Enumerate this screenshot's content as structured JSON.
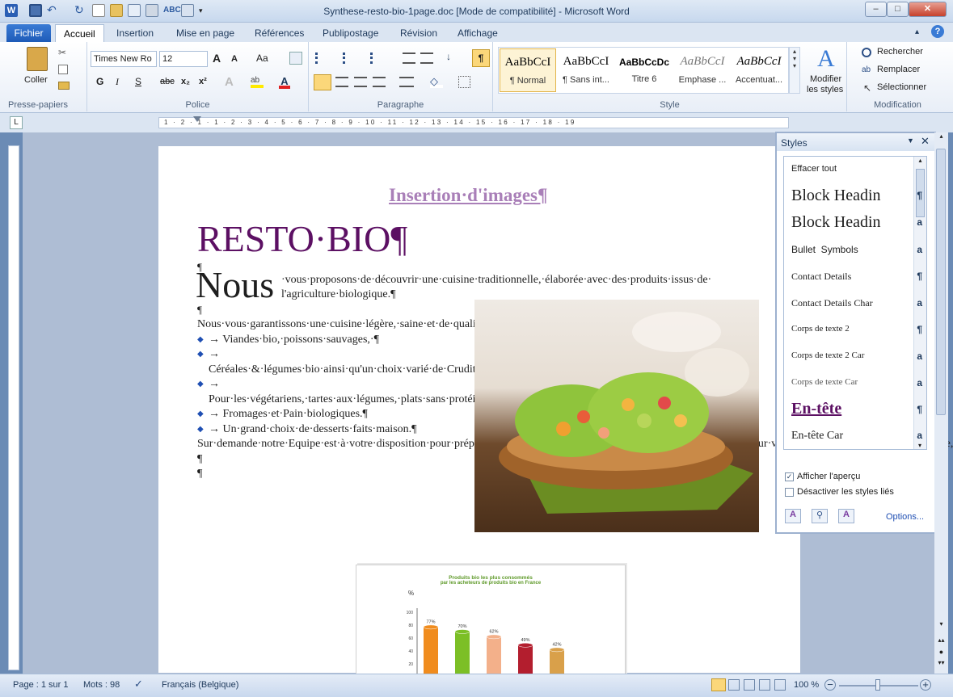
{
  "window": {
    "title": "Synthese-resto-bio-1page.doc [Mode de compatibilité]  -  Microsoft Word",
    "min": "–",
    "max": "□",
    "close": "✕"
  },
  "tabs": {
    "file": "Fichier",
    "items": [
      "Accueil",
      "Insertion",
      "Mise en page",
      "Références",
      "Publipostage",
      "Révision",
      "Affichage"
    ]
  },
  "ribbon": {
    "clipboard": {
      "paste": "Coller",
      "label": "Presse-papiers"
    },
    "font": {
      "name": "Times New Ro",
      "size": "12",
      "label": "Police",
      "grow": "A",
      "shrink": "A",
      "case": "Aa",
      "bold": "G",
      "italic": "I",
      "underline": "S",
      "strike": "abc",
      "sub": "x₂",
      "sup": "x²"
    },
    "paragraph": {
      "label": "Paragraphe",
      "pilcrow": "¶"
    },
    "styles": {
      "label": "Style",
      "items": [
        {
          "preview": "AaBbCcI",
          "name": "¶ Normal"
        },
        {
          "preview": "AaBbCcI",
          "name": "¶ Sans int..."
        },
        {
          "preview": "AaBbCcDc",
          "name": "Titre 6"
        },
        {
          "preview": "AaBbCcI",
          "name": "Emphase ..."
        },
        {
          "preview": "AaBbCcI",
          "name": "Accentuat..."
        }
      ],
      "modify_line1": "Modifier",
      "modify_line2": "les styles"
    },
    "edit": {
      "label": "Modification",
      "find": "Rechercher",
      "replace": "Remplacer",
      "select": "Sélectionner"
    }
  },
  "ruler": {
    "marks": "1 · 2 · 1 · 1 · 2 · 3 · 4 · 5 · 6 · 7 · 8 · 9 · 10 · 11 · 12 · 13 · 14 · 15 · 16 · 17 · 18 · 19"
  },
  "document": {
    "heading": "Insertion·d'images¶",
    "title": "RESTO·BIO¶",
    "pilcrow": "¶",
    "dropcap": "Nous",
    "intro_1": "·vous·proposons·de·découvrir·une·cuisine·traditionnelle,·élaborée·avec·des·produits·issus·de·",
    "intro_2": "l'agriculture·biologique.¶",
    "p1": "Nous·vous·garantissons·une·cuisine·légère,·saine·et·de·qualité·comportant·:¶",
    "bullets": [
      "→   Viandes·bio,·poissons·sauvages,·¶",
      "→   Céréales·&·légumes·bio·ainsi·qu'un·choix·varié·de·Crudités·de·saison.¶",
      "→   Pour·les·végétariens,·tartes·aux·légumes,·plats·sans·protéines·animales·et·salades·variées.¶",
      "→   Fromages·et·Pain·biologiques.¶",
      "→   Un·grand·choix·de·desserts·faits·maison.¶"
    ],
    "p2": "Sur·demande·notre·Equipe·est·à·votre·disposition·pour·préparer·selon·vos·envies,·toute·une·gamme·de·plats·et·menus·pour·vos·réunions,·banquet,·fêtes·de·famille,·etc...¶"
  },
  "chart_data": {
    "type": "bar",
    "title": "Produits bio les plus consommés",
    "subtitle": "par les acheteurs de produits bio en France",
    "ylabel": "%",
    "ylim": [
      0,
      100
    ],
    "yticks": [
      20,
      40,
      60,
      80,
      100
    ],
    "categories": [
      "",
      "",
      "",
      "",
      ""
    ],
    "values": [
      77,
      70,
      62,
      49,
      42
    ],
    "labels": [
      "77%",
      "70%",
      "62%",
      "49%",
      "42%"
    ],
    "colors": [
      "#f08c1e",
      "#7cbf26",
      "#f3b08a",
      "#b31e2e",
      "#d9a04a"
    ]
  },
  "styles_pane": {
    "title": "Styles",
    "items": [
      {
        "name": "Effacer tout",
        "mark": ""
      },
      {
        "name": "Block Headin",
        "mark": "¶"
      },
      {
        "name": "Block Headin",
        "mark": "a"
      },
      {
        "name": "Bullet  Symbols",
        "mark": "a"
      },
      {
        "name": "Contact Details",
        "mark": "¶"
      },
      {
        "name": "Contact Details Char",
        "mark": "a"
      },
      {
        "name": "Corps de texte 2",
        "mark": "¶"
      },
      {
        "name": "Corps de texte 2 Car",
        "mark": "a"
      },
      {
        "name": "Corps de texte Car",
        "mark": "a"
      },
      {
        "name": "En-tête",
        "mark": "¶"
      },
      {
        "name": "En-tête Car",
        "mark": "a"
      }
    ],
    "show_preview": "Afficher l'aperçu",
    "disable_linked": "Désactiver les styles liés",
    "options": "Options..."
  },
  "status": {
    "page": "Page : 1 sur 1",
    "words": "Mots : 98",
    "language": "Français (Belgique)",
    "zoom": "100 %"
  }
}
